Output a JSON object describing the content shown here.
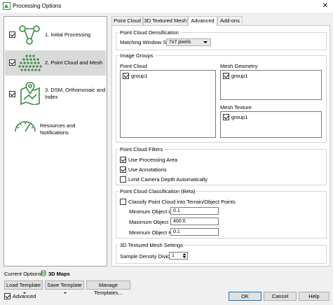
{
  "window": {
    "title": "Processing Options",
    "close_symbol": "✕"
  },
  "steps": [
    {
      "label": "1. Initial Processing",
      "checked": true
    },
    {
      "label": "2. Point Cloud and Mesh",
      "checked": true,
      "selected": true
    },
    {
      "label": "3. DSM, Orthomosaic and Index",
      "checked": true
    },
    {
      "label": "Resources and Notifications"
    }
  ],
  "tabs": [
    "Point Cloud",
    "3D Textured Mesh",
    "Advanced",
    "Add-ons"
  ],
  "advanced": {
    "densification": {
      "title": "Point Cloud Densification",
      "matching_label": "Matching Window Size:",
      "matching_value": "7x7 pixels"
    },
    "image_groups": {
      "title": "Image Groups",
      "point_cloud_label": "Point Cloud",
      "point_cloud_items": [
        "group1"
      ],
      "mesh_geometry_label": "Mesh Geometry",
      "mesh_geometry_items": [
        "group1"
      ],
      "mesh_texture_label": "Mesh Texture",
      "mesh_texture_items": [
        "group1"
      ]
    },
    "filters": {
      "title": "Point Cloud Filters",
      "use_processing_area": "Use Processing Area",
      "use_annotations": "Use Annotations",
      "limit_camera_depth": "Limit Camera Depth Automatically"
    },
    "classification": {
      "title": "Point Cloud Classification (Beta)",
      "classify_label": "Classify Point Cloud into Terrain/Object Points",
      "min_length_label": "Minimum Object Length [m]:",
      "min_length_value": "0.1",
      "max_length_label": "Maximum Object Length [m]:",
      "max_length_value": "400.0",
      "min_height_label": "Minimum Object Height [m]:",
      "min_height_value": "0.1"
    },
    "mesh_settings": {
      "title": "3D Textured Mesh Settings",
      "density_label": "Sample Density Divider:",
      "density_value": "1"
    }
  },
  "footer": {
    "current_options_label": "Current Options:",
    "current_options_value": "3D Maps",
    "load_template": "Load Template",
    "save_template": "Save Template",
    "manage_templates": "Manage Templates...",
    "advanced_label": "Advanced",
    "ok": "OK",
    "cancel": "Cancel",
    "help": "Help"
  },
  "colors": {
    "icon_green": "#3a8a3f",
    "accent_blue": "#0078d7"
  }
}
